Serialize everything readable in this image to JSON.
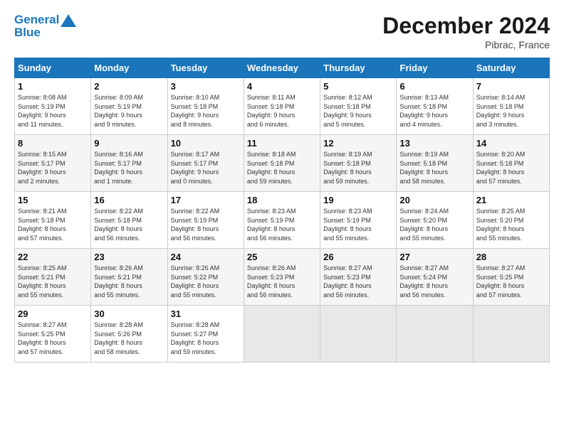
{
  "header": {
    "logo_line1": "General",
    "logo_line2": "Blue",
    "month": "December 2024",
    "location": "Pibrac, France"
  },
  "days_of_week": [
    "Sunday",
    "Monday",
    "Tuesday",
    "Wednesday",
    "Thursday",
    "Friday",
    "Saturday"
  ],
  "weeks": [
    [
      {
        "day": "1",
        "detail": "Sunrise: 8:08 AM\nSunset: 5:19 PM\nDaylight: 9 hours\nand 11 minutes."
      },
      {
        "day": "2",
        "detail": "Sunrise: 8:09 AM\nSunset: 5:19 PM\nDaylight: 9 hours\nand 9 minutes."
      },
      {
        "day": "3",
        "detail": "Sunrise: 8:10 AM\nSunset: 5:18 PM\nDaylight: 9 hours\nand 8 minutes."
      },
      {
        "day": "4",
        "detail": "Sunrise: 8:11 AM\nSunset: 5:18 PM\nDaylight: 9 hours\nand 6 minutes."
      },
      {
        "day": "5",
        "detail": "Sunrise: 8:12 AM\nSunset: 5:18 PM\nDaylight: 9 hours\nand 5 minutes."
      },
      {
        "day": "6",
        "detail": "Sunrise: 8:13 AM\nSunset: 5:18 PM\nDaylight: 9 hours\nand 4 minutes."
      },
      {
        "day": "7",
        "detail": "Sunrise: 8:14 AM\nSunset: 5:18 PM\nDaylight: 9 hours\nand 3 minutes."
      }
    ],
    [
      {
        "day": "8",
        "detail": "Sunrise: 8:15 AM\nSunset: 5:17 PM\nDaylight: 9 hours\nand 2 minutes."
      },
      {
        "day": "9",
        "detail": "Sunrise: 8:16 AM\nSunset: 5:17 PM\nDaylight: 9 hours\nand 1 minute."
      },
      {
        "day": "10",
        "detail": "Sunrise: 8:17 AM\nSunset: 5:17 PM\nDaylight: 9 hours\nand 0 minutes."
      },
      {
        "day": "11",
        "detail": "Sunrise: 8:18 AM\nSunset: 5:18 PM\nDaylight: 8 hours\nand 59 minutes."
      },
      {
        "day": "12",
        "detail": "Sunrise: 8:19 AM\nSunset: 5:18 PM\nDaylight: 8 hours\nand 59 minutes."
      },
      {
        "day": "13",
        "detail": "Sunrise: 8:19 AM\nSunset: 5:18 PM\nDaylight: 8 hours\nand 58 minutes."
      },
      {
        "day": "14",
        "detail": "Sunrise: 8:20 AM\nSunset: 5:18 PM\nDaylight: 8 hours\nand 57 minutes."
      }
    ],
    [
      {
        "day": "15",
        "detail": "Sunrise: 8:21 AM\nSunset: 5:18 PM\nDaylight: 8 hours\nand 57 minutes."
      },
      {
        "day": "16",
        "detail": "Sunrise: 8:22 AM\nSunset: 5:18 PM\nDaylight: 8 hours\nand 56 minutes."
      },
      {
        "day": "17",
        "detail": "Sunrise: 8:22 AM\nSunset: 5:19 PM\nDaylight: 8 hours\nand 56 minutes."
      },
      {
        "day": "18",
        "detail": "Sunrise: 8:23 AM\nSunset: 5:19 PM\nDaylight: 8 hours\nand 56 minutes."
      },
      {
        "day": "19",
        "detail": "Sunrise: 8:23 AM\nSunset: 5:19 PM\nDaylight: 8 hours\nand 55 minutes."
      },
      {
        "day": "20",
        "detail": "Sunrise: 8:24 AM\nSunset: 5:20 PM\nDaylight: 8 hours\nand 55 minutes."
      },
      {
        "day": "21",
        "detail": "Sunrise: 8:25 AM\nSunset: 5:20 PM\nDaylight: 8 hours\nand 55 minutes."
      }
    ],
    [
      {
        "day": "22",
        "detail": "Sunrise: 8:25 AM\nSunset: 5:21 PM\nDaylight: 8 hours\nand 55 minutes."
      },
      {
        "day": "23",
        "detail": "Sunrise: 8:26 AM\nSunset: 5:21 PM\nDaylight: 8 hours\nand 55 minutes."
      },
      {
        "day": "24",
        "detail": "Sunrise: 8:26 AM\nSunset: 5:22 PM\nDaylight: 8 hours\nand 55 minutes."
      },
      {
        "day": "25",
        "detail": "Sunrise: 8:26 AM\nSunset: 5:23 PM\nDaylight: 8 hours\nand 56 minutes."
      },
      {
        "day": "26",
        "detail": "Sunrise: 8:27 AM\nSunset: 5:23 PM\nDaylight: 8 hours\nand 56 minutes."
      },
      {
        "day": "27",
        "detail": "Sunrise: 8:27 AM\nSunset: 5:24 PM\nDaylight: 8 hours\nand 56 minutes."
      },
      {
        "day": "28",
        "detail": "Sunrise: 8:27 AM\nSunset: 5:25 PM\nDaylight: 8 hours\nand 57 minutes."
      }
    ],
    [
      {
        "day": "29",
        "detail": "Sunrise: 8:27 AM\nSunset: 5:25 PM\nDaylight: 8 hours\nand 57 minutes."
      },
      {
        "day": "30",
        "detail": "Sunrise: 8:28 AM\nSunset: 5:26 PM\nDaylight: 8 hours\nand 58 minutes."
      },
      {
        "day": "31",
        "detail": "Sunrise: 8:28 AM\nSunset: 5:27 PM\nDaylight: 8 hours\nand 59 minutes."
      },
      {
        "day": "",
        "detail": ""
      },
      {
        "day": "",
        "detail": ""
      },
      {
        "day": "",
        "detail": ""
      },
      {
        "day": "",
        "detail": ""
      }
    ]
  ]
}
